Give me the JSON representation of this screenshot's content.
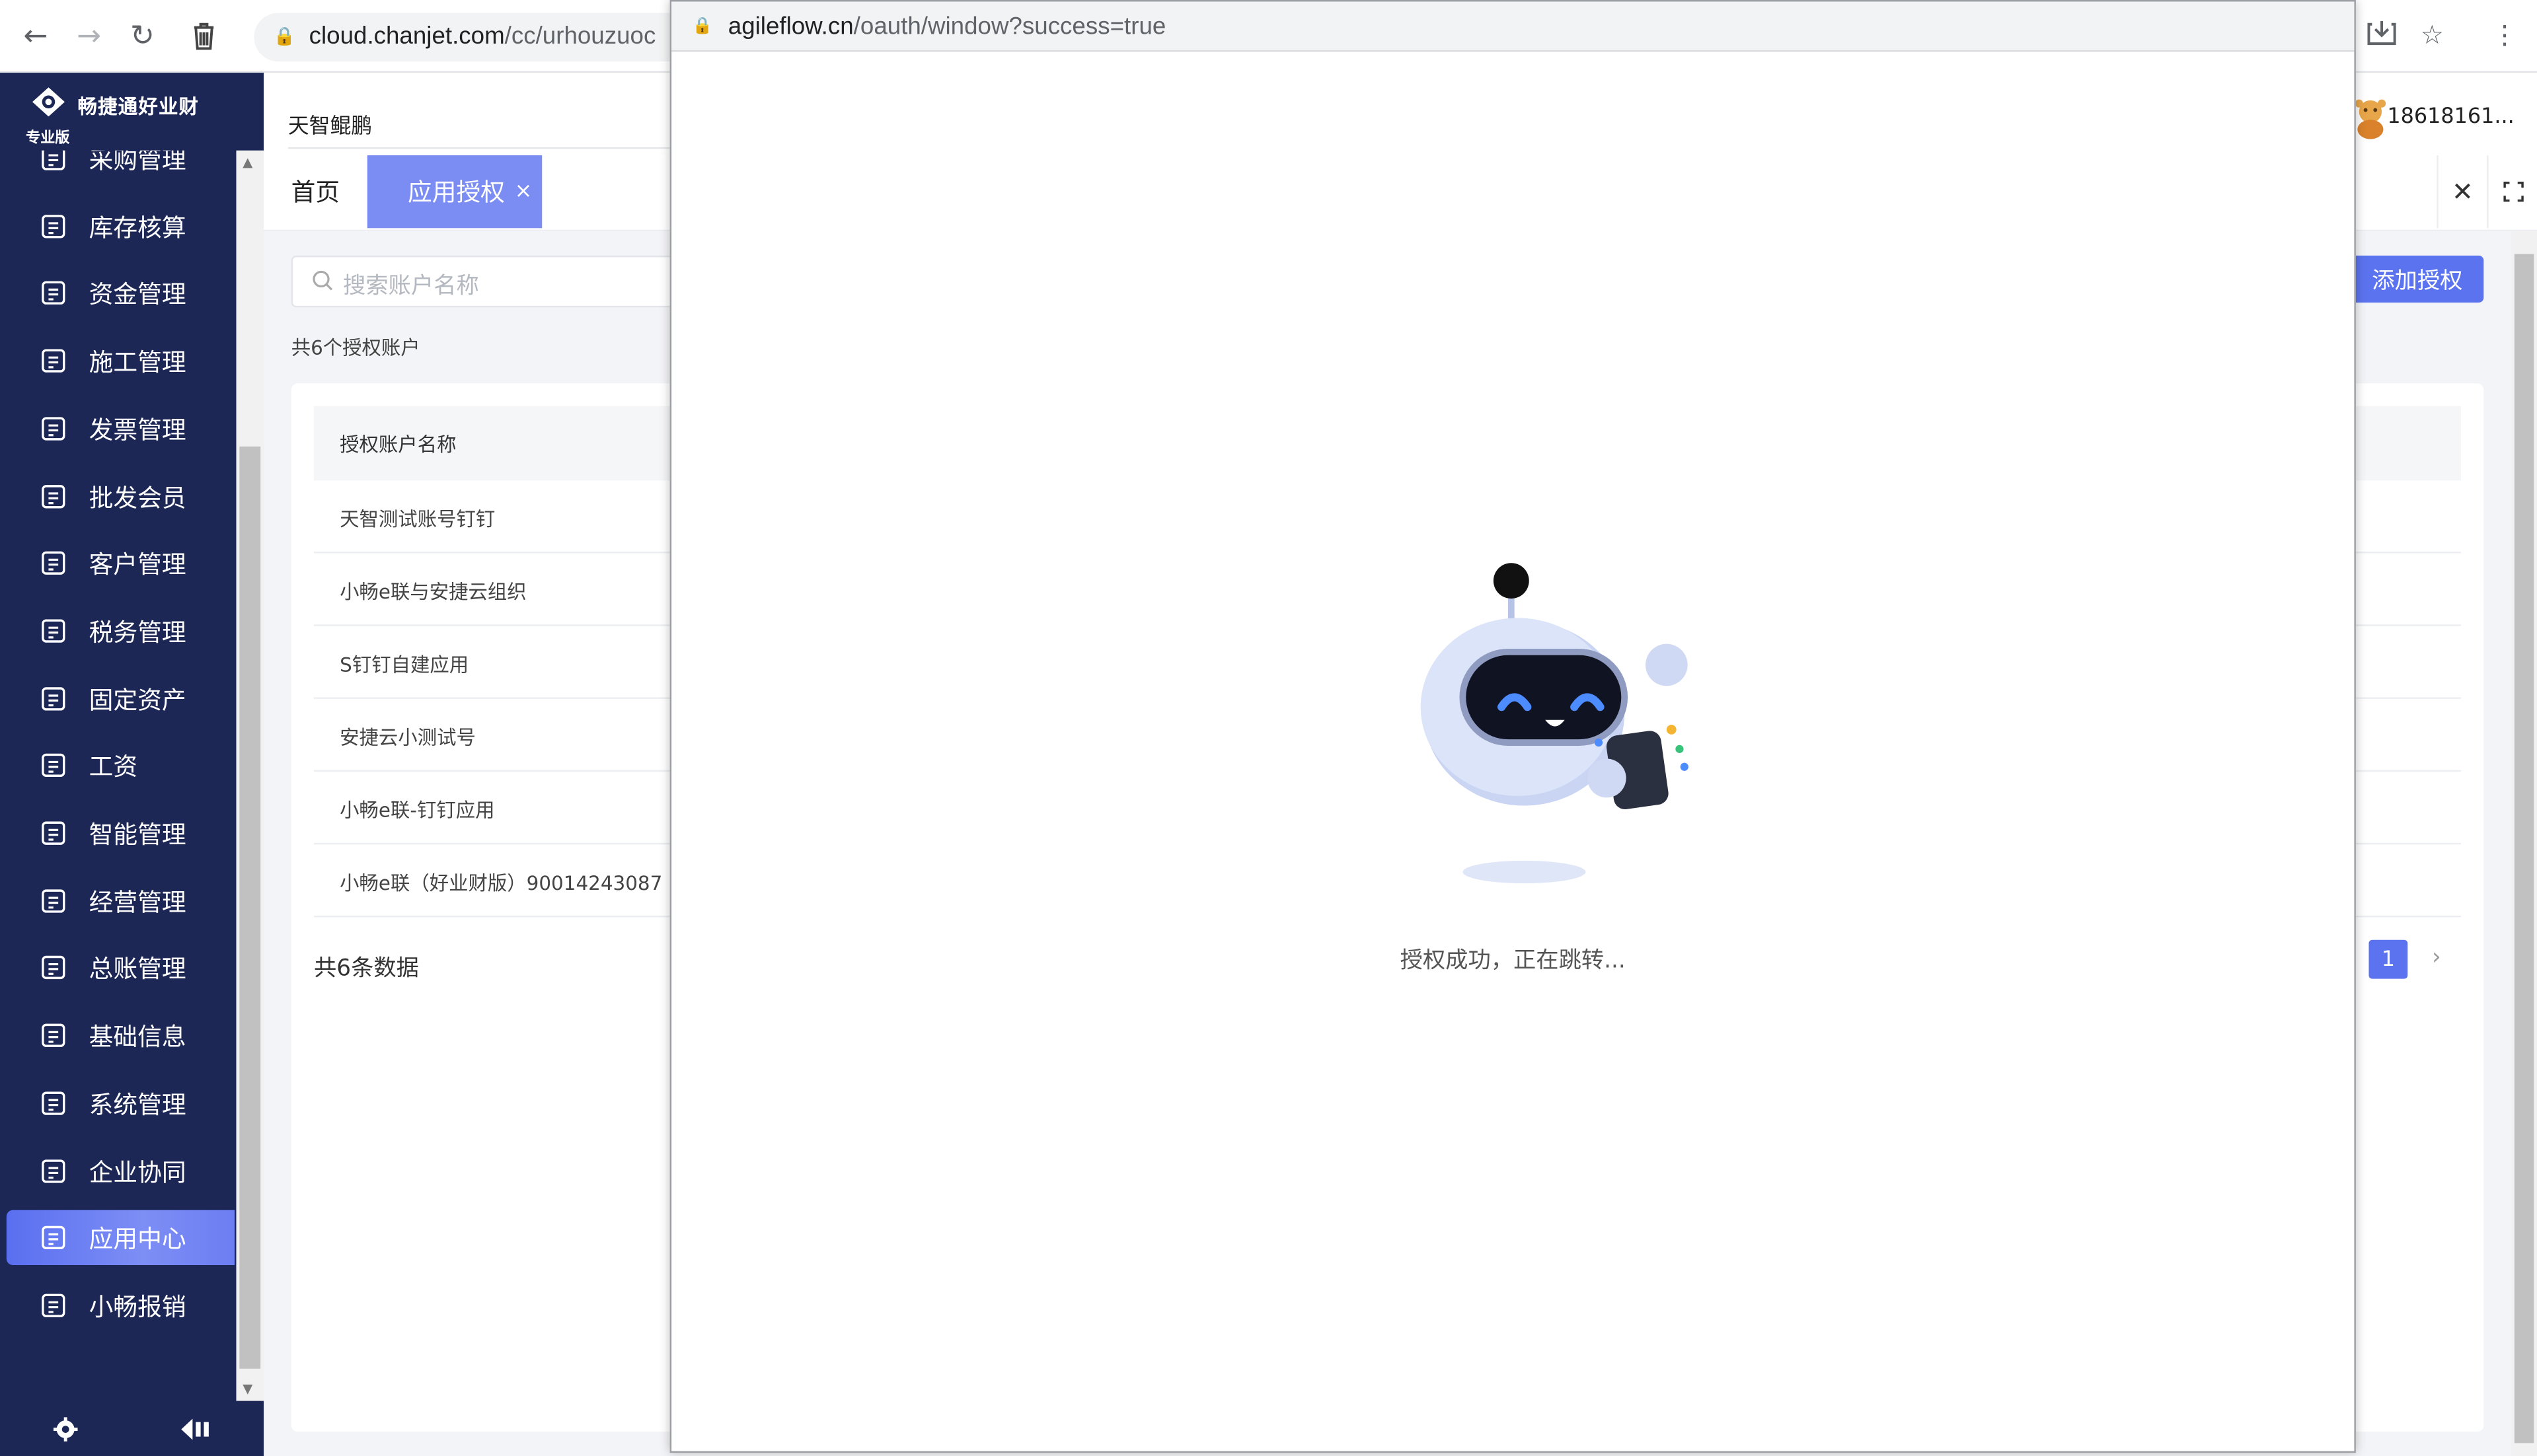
{
  "browser": {
    "url_domain": "cloud.chanjet.com",
    "url_path": "/cc/urhouzuoc"
  },
  "brand": {
    "name": "畅捷通好业财",
    "edition": "专业版"
  },
  "sidebar": {
    "items": [
      {
        "label": "采购管理",
        "icon": "purchase-icon"
      },
      {
        "label": "库存核算",
        "icon": "warehouse-icon"
      },
      {
        "label": "资金管理",
        "icon": "money-bag-icon"
      },
      {
        "label": "施工管理",
        "icon": "construction-doc-icon"
      },
      {
        "label": "发票管理",
        "icon": "invoice-icon"
      },
      {
        "label": "批发会员",
        "icon": "member-icon"
      },
      {
        "label": "客户管理",
        "icon": "umbrella-icon"
      },
      {
        "label": "税务管理",
        "icon": "tax-icon"
      },
      {
        "label": "固定资产",
        "icon": "building-icon"
      },
      {
        "label": "工资",
        "icon": "salary-icon"
      },
      {
        "label": "智能管理",
        "icon": "heart-icon"
      },
      {
        "label": "经营管理",
        "icon": "clipboard-icon"
      },
      {
        "label": "总账管理",
        "icon": "ledger-icon"
      },
      {
        "label": "基础信息",
        "icon": "info-card-icon"
      },
      {
        "label": "系统管理",
        "icon": "system-icon"
      },
      {
        "label": "企业协同",
        "icon": "collab-icon"
      },
      {
        "label": "应用中心",
        "icon": "app-center-icon",
        "active": true
      },
      {
        "label": "小畅报销",
        "icon": "reimburse-icon"
      }
    ]
  },
  "header": {
    "company": "天智鲲鹏",
    "user": "18618161..."
  },
  "tabs": {
    "home": "首页",
    "active": "应用授权",
    "close": "×"
  },
  "main": {
    "search_placeholder": "搜索账户名称",
    "count_note": "共6个授权账户",
    "add_button": "添加授权",
    "table_header": "授权账户名称",
    "rows": [
      "天智测试账号钉钉",
      "小畅e联与安捷云组织",
      "S钉钉自建应用",
      "安捷云小测试号",
      "小畅e联-钉钉应用",
      "小畅e联（好业财版）90014243087"
    ],
    "total": "共6条数据",
    "page": "1",
    "next": "›"
  },
  "popup": {
    "url_domain": "agileflow.cn",
    "url_path": "/oauth/window?success=true",
    "message": "授权成功，正在跳转..."
  }
}
